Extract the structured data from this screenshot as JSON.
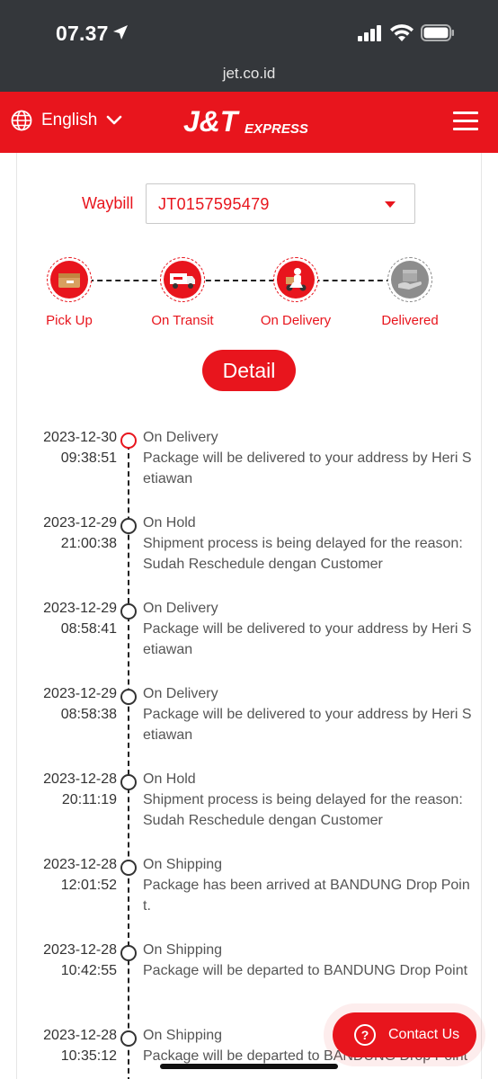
{
  "status_bar": {
    "time": "07.37",
    "url": "jet.co.id"
  },
  "header": {
    "language": "English",
    "logo_text_main": "J&T",
    "logo_text_sub": "EXPRESS",
    "brand_color": "#e8151d"
  },
  "waybill": {
    "label": "Waybill",
    "value": "JT0157595479"
  },
  "steps": [
    {
      "label": "Pick Up",
      "icon": "pickup-box-icon",
      "active": true
    },
    {
      "label": "On Transit",
      "icon": "truck-icon",
      "active": true
    },
    {
      "label": "On Delivery",
      "icon": "courier-icon",
      "active": true
    },
    {
      "label": "Delivered",
      "icon": "delivered-box-icon",
      "active": false
    }
  ],
  "detail_button": "Detail",
  "events": [
    {
      "date": "2023-12-30",
      "time": "09:38:51",
      "status": "On Delivery",
      "desc": "Package will be delivered to your address by Heri Setiawan"
    },
    {
      "date": "2023-12-29",
      "time": "21:00:38",
      "status": "On Hold",
      "desc": "Shipment process is being delayed for the reason: Sudah Reschedule dengan Customer"
    },
    {
      "date": "2023-12-29",
      "time": "08:58:41",
      "status": "On Delivery",
      "desc": "Package will be delivered to your address by Heri Setiawan"
    },
    {
      "date": "2023-12-29",
      "time": "08:58:38",
      "status": "On Delivery",
      "desc": "Package will be delivered to your address by Heri Setiawan"
    },
    {
      "date": "2023-12-28",
      "time": "20:11:19",
      "status": "On Hold",
      "desc": "Shipment process is being delayed for the reason: Sudah Reschedule dengan Customer"
    },
    {
      "date": "2023-12-28",
      "time": "12:01:52",
      "status": "On Shipping",
      "desc": "Package has been arrived at BANDUNG Drop Point."
    },
    {
      "date": "2023-12-28",
      "time": "10:42:55",
      "status": "On Shipping",
      "desc": "Package will be departed to BANDUNG Drop Point"
    },
    {
      "date": "2023-12-28",
      "time": "10:35:12",
      "status": "On Shipping",
      "desc": "Package will be departed to BANDUNG Drop Point"
    }
  ],
  "contact_button": "Contact Us"
}
